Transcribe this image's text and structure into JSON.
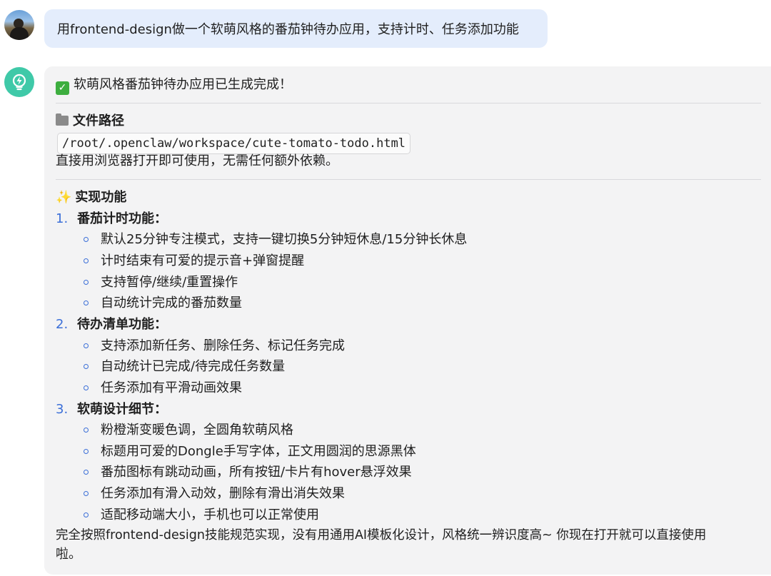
{
  "user_message": {
    "text": "用frontend-design做一个软萌风格的番茄钟待办应用，支持计时、任务添加功能"
  },
  "assistant": {
    "status_line": "软萌风格番茄钟待办应用已生成完成！",
    "file_section_title": "文件路径",
    "file_path": "/root/.openclaw/workspace/cute-tomato-todo.html",
    "file_note": "直接用浏览器打开即可使用，无需任何额外依赖。",
    "features_title": "实现功能",
    "sections": [
      {
        "number": "1.",
        "title": "番茄计时功能：",
        "items": [
          "默认25分钟专注模式，支持一键切换5分钟短休息/15分钟长休息",
          "计时结束有可爱的提示音+弹窗提醒",
          "支持暂停/继续/重置操作",
          "自动统计完成的番茄数量"
        ]
      },
      {
        "number": "2.",
        "title": "待办清单功能：",
        "items": [
          "支持添加新任务、删除任务、标记任务完成",
          "自动统计已完成/待完成任务数量",
          "任务添加有平滑动画效果"
        ]
      },
      {
        "number": "3.",
        "title": "软萌设计细节：",
        "items": [
          "粉橙渐变暖色调，全圆角软萌风格",
          "标题用可爱的Dongle手写字体，正文用圆润的思源黑体",
          "番茄图标有跳动动画，所有按钮/卡片有hover悬浮效果",
          "任务添加有滑入动效，删除有滑出消失效果",
          "适配移动端大小，手机也可以正常使用"
        ]
      }
    ],
    "closing_line_1": "完全按照frontend-design技能规范实现，没有用通用AI模板化设计，风格统一辨识度高~ 你现在打开就可以直接使用",
    "closing_line_2": "啦。"
  },
  "colors": {
    "user_bubble": "#e4edfc",
    "assistant_bubble": "#f3f3f4",
    "assistant_avatar": "#3fc9a8",
    "list_accent": "#3b6fd8"
  },
  "icons": {
    "status": "check-mark-icon",
    "file": "folder-icon",
    "features": "sparkles-icon",
    "assistant_avatar": "lightbulb-bolt-icon"
  }
}
